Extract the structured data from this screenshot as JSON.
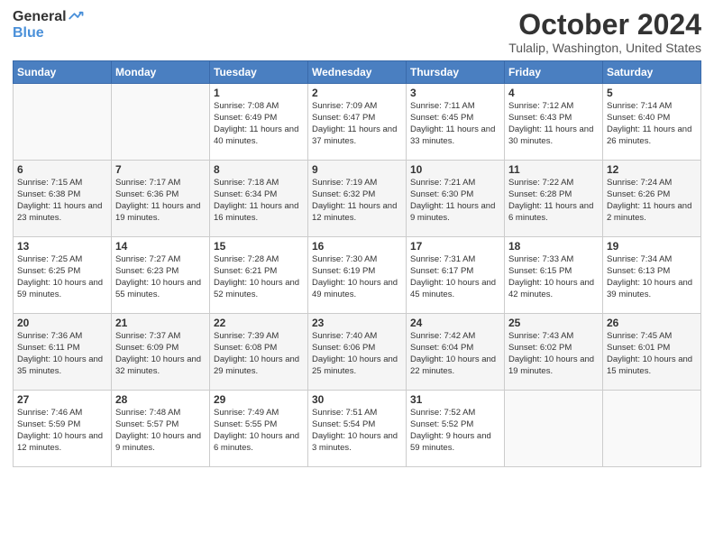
{
  "header": {
    "logo_general": "General",
    "logo_blue": "Blue",
    "month_title": "October 2024",
    "location": "Tulalip, Washington, United States"
  },
  "days_of_week": [
    "Sunday",
    "Monday",
    "Tuesday",
    "Wednesday",
    "Thursday",
    "Friday",
    "Saturday"
  ],
  "weeks": [
    [
      {
        "day": "",
        "info": ""
      },
      {
        "day": "",
        "info": ""
      },
      {
        "day": "1",
        "info": "Sunrise: 7:08 AM\nSunset: 6:49 PM\nDaylight: 11 hours and 40 minutes."
      },
      {
        "day": "2",
        "info": "Sunrise: 7:09 AM\nSunset: 6:47 PM\nDaylight: 11 hours and 37 minutes."
      },
      {
        "day": "3",
        "info": "Sunrise: 7:11 AM\nSunset: 6:45 PM\nDaylight: 11 hours and 33 minutes."
      },
      {
        "day": "4",
        "info": "Sunrise: 7:12 AM\nSunset: 6:43 PM\nDaylight: 11 hours and 30 minutes."
      },
      {
        "day": "5",
        "info": "Sunrise: 7:14 AM\nSunset: 6:40 PM\nDaylight: 11 hours and 26 minutes."
      }
    ],
    [
      {
        "day": "6",
        "info": "Sunrise: 7:15 AM\nSunset: 6:38 PM\nDaylight: 11 hours and 23 minutes."
      },
      {
        "day": "7",
        "info": "Sunrise: 7:17 AM\nSunset: 6:36 PM\nDaylight: 11 hours and 19 minutes."
      },
      {
        "day": "8",
        "info": "Sunrise: 7:18 AM\nSunset: 6:34 PM\nDaylight: 11 hours and 16 minutes."
      },
      {
        "day": "9",
        "info": "Sunrise: 7:19 AM\nSunset: 6:32 PM\nDaylight: 11 hours and 12 minutes."
      },
      {
        "day": "10",
        "info": "Sunrise: 7:21 AM\nSunset: 6:30 PM\nDaylight: 11 hours and 9 minutes."
      },
      {
        "day": "11",
        "info": "Sunrise: 7:22 AM\nSunset: 6:28 PM\nDaylight: 11 hours and 6 minutes."
      },
      {
        "day": "12",
        "info": "Sunrise: 7:24 AM\nSunset: 6:26 PM\nDaylight: 11 hours and 2 minutes."
      }
    ],
    [
      {
        "day": "13",
        "info": "Sunrise: 7:25 AM\nSunset: 6:25 PM\nDaylight: 10 hours and 59 minutes."
      },
      {
        "day": "14",
        "info": "Sunrise: 7:27 AM\nSunset: 6:23 PM\nDaylight: 10 hours and 55 minutes."
      },
      {
        "day": "15",
        "info": "Sunrise: 7:28 AM\nSunset: 6:21 PM\nDaylight: 10 hours and 52 minutes."
      },
      {
        "day": "16",
        "info": "Sunrise: 7:30 AM\nSunset: 6:19 PM\nDaylight: 10 hours and 49 minutes."
      },
      {
        "day": "17",
        "info": "Sunrise: 7:31 AM\nSunset: 6:17 PM\nDaylight: 10 hours and 45 minutes."
      },
      {
        "day": "18",
        "info": "Sunrise: 7:33 AM\nSunset: 6:15 PM\nDaylight: 10 hours and 42 minutes."
      },
      {
        "day": "19",
        "info": "Sunrise: 7:34 AM\nSunset: 6:13 PM\nDaylight: 10 hours and 39 minutes."
      }
    ],
    [
      {
        "day": "20",
        "info": "Sunrise: 7:36 AM\nSunset: 6:11 PM\nDaylight: 10 hours and 35 minutes."
      },
      {
        "day": "21",
        "info": "Sunrise: 7:37 AM\nSunset: 6:09 PM\nDaylight: 10 hours and 32 minutes."
      },
      {
        "day": "22",
        "info": "Sunrise: 7:39 AM\nSunset: 6:08 PM\nDaylight: 10 hours and 29 minutes."
      },
      {
        "day": "23",
        "info": "Sunrise: 7:40 AM\nSunset: 6:06 PM\nDaylight: 10 hours and 25 minutes."
      },
      {
        "day": "24",
        "info": "Sunrise: 7:42 AM\nSunset: 6:04 PM\nDaylight: 10 hours and 22 minutes."
      },
      {
        "day": "25",
        "info": "Sunrise: 7:43 AM\nSunset: 6:02 PM\nDaylight: 10 hours and 19 minutes."
      },
      {
        "day": "26",
        "info": "Sunrise: 7:45 AM\nSunset: 6:01 PM\nDaylight: 10 hours and 15 minutes."
      }
    ],
    [
      {
        "day": "27",
        "info": "Sunrise: 7:46 AM\nSunset: 5:59 PM\nDaylight: 10 hours and 12 minutes."
      },
      {
        "day": "28",
        "info": "Sunrise: 7:48 AM\nSunset: 5:57 PM\nDaylight: 10 hours and 9 minutes."
      },
      {
        "day": "29",
        "info": "Sunrise: 7:49 AM\nSunset: 5:55 PM\nDaylight: 10 hours and 6 minutes."
      },
      {
        "day": "30",
        "info": "Sunrise: 7:51 AM\nSunset: 5:54 PM\nDaylight: 10 hours and 3 minutes."
      },
      {
        "day": "31",
        "info": "Sunrise: 7:52 AM\nSunset: 5:52 PM\nDaylight: 9 hours and 59 minutes."
      },
      {
        "day": "",
        "info": ""
      },
      {
        "day": "",
        "info": ""
      }
    ]
  ]
}
